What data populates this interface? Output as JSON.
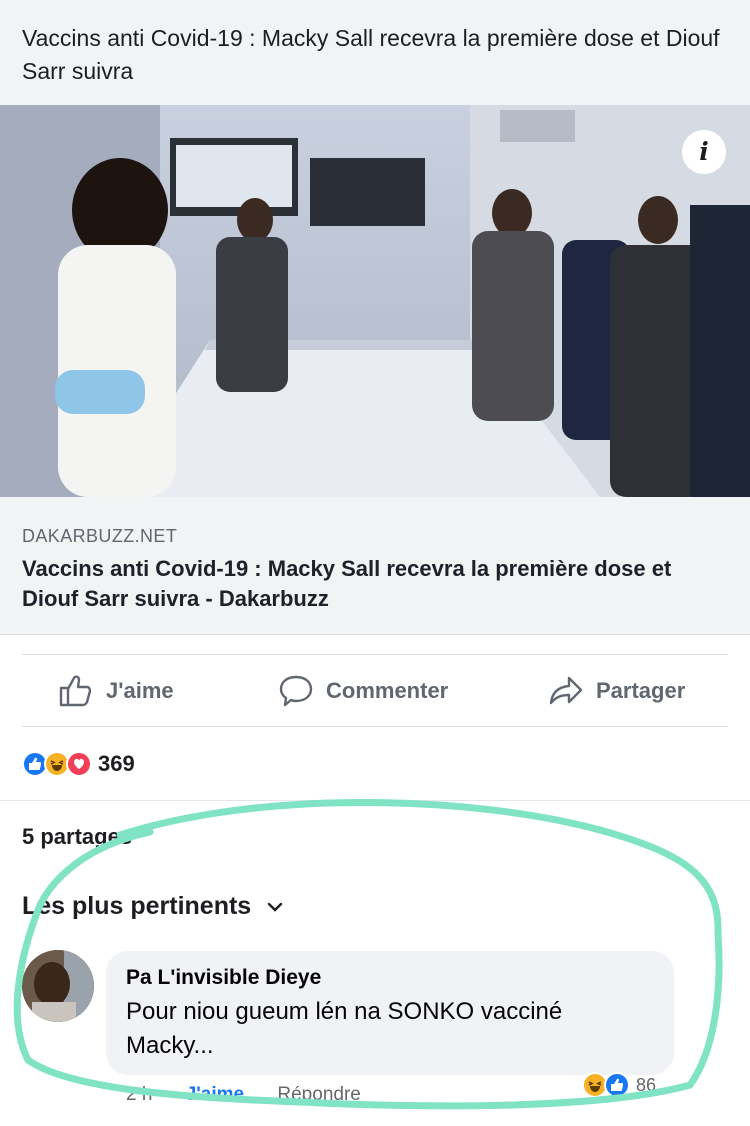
{
  "post": {
    "text": "Vaccins anti Covid-19 : Macky Sall recevra la première dose et Diouf Sarr suivra"
  },
  "link_preview": {
    "domain": "DAKARBUZZ.NET",
    "title": "Vaccins anti Covid-19 : Macky Sall recevra la première dose et Diouf Sarr suivra - Dakarbuzz",
    "info_icon": "i"
  },
  "actions": {
    "like": "J'aime",
    "comment": "Commenter",
    "share": "Partager"
  },
  "reactions": {
    "icons": [
      "like-icon",
      "haha-icon",
      "love-icon"
    ],
    "count": "369"
  },
  "shares": "5 partages",
  "comments_sort": "Les plus pertinents",
  "comment": {
    "author": "Pa L'invisible Dieye",
    "text": "Pour niou gueum lén na SONKO vacciné Macky...",
    "time": "2 h",
    "like_label": "J'aime",
    "reply_label": "Répondre",
    "reaction_icons": [
      "haha-icon",
      "like-icon"
    ],
    "reaction_count": "86"
  },
  "colors": {
    "facebook_blue": "#1877f2",
    "love_red": "#f33e58",
    "haha_yellow": "#f7b125",
    "highlight_stroke": "#7fe3c4",
    "card_background": "#f2f3f5"
  }
}
